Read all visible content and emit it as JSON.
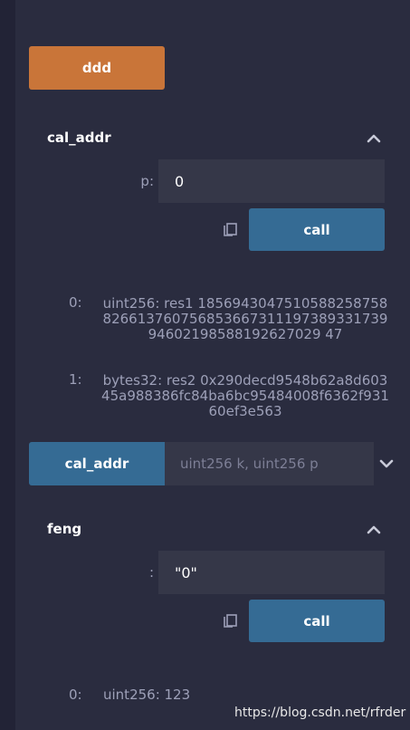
{
  "transact_button": {
    "label": "ddd"
  },
  "functions": [
    {
      "title": "cal_addr",
      "param_label": "p:",
      "param_value": "0",
      "call_label": "call",
      "outputs": [
        {
          "index": "0:",
          "text": "uint256: res1 185694304751058825875882661376075685366731119738933173994602198588192627029 47"
        },
        {
          "index": "1:",
          "text": "bytes32: res2 0x290decd9548b62a8d60345a988386fc84ba6bc95484008f6362f93160ef3e563"
        }
      ]
    },
    {
      "title": "feng",
      "param_label": ":",
      "param_value": "\"0\"",
      "call_label": "call",
      "outputs": [
        {
          "index": "0:",
          "text": "uint256: 123"
        }
      ]
    }
  ],
  "collapsed_function": {
    "label": "cal_addr",
    "args_placeholder": "uint256 k, uint256 p"
  },
  "watermark": "https://blog.csdn.net/rfrder",
  "colors": {
    "background": "#2a2c3f",
    "transact_accent": "#c97539",
    "call_accent": "#356b94",
    "input_bg": "#353748"
  }
}
